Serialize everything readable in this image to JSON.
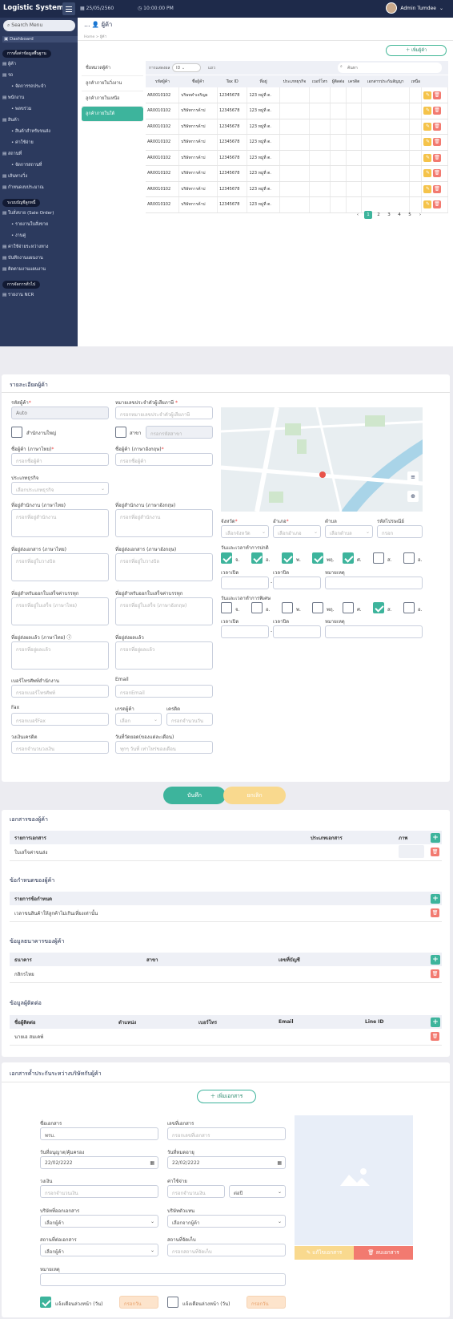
{
  "app_title": "Logistic System",
  "topbar": {
    "date": "25/05/2560",
    "time": "10:00:00 PM",
    "user": "Admin Tumdee"
  },
  "sidebar": {
    "search_placeholder": "Search Menu",
    "dashboard": "Dashboard",
    "sec1": "การตั้งค่าข้อมูลพื้นฐาน",
    "items1": [
      "ผู้ค้า",
      "รถ",
      "จัดการรถประจำ",
      "พนักงาน",
      "พลขร่วม",
      "สินค้า",
      "สินค้าสำหรับขนส่ง",
      "ค่าใช้จ่าย",
      "สถานที่",
      "จัดการสถานที่",
      "เส้นทางวิ่ง",
      "กำหนดงบประมาณ"
    ],
    "sec2": "ระบบบัญชีลูกหนี้",
    "items2": [
      "ใบสั่งขาย (Sale Order)",
      "รายงานใบสั่งขาย",
      "งานคู่",
      "ค่าใช้จ่ายระหว่างทาง",
      "บันทึกงานแผนงาน",
      "ติดตามงานแผนงาน"
    ],
    "sec3": "การจัดการทั่วไป",
    "items3": [
      "รายงาน NCR"
    ]
  },
  "page": {
    "title": "ผู้ค้า",
    "breadcrumb": "Home > ผู้ค้า",
    "add_label": "เพิ่มผู้ค้า",
    "tabs": [
      "ชื่อหมวดผู้ค้า",
      "ลูกค้าภายในวิ่งงาน",
      "ลูกค้าภายในเหนือ",
      "ลูกค้าภายในใต้"
    ],
    "filter": {
      "label": "การแสดงผล",
      "select": "ID",
      "extra": "แถว",
      "search": "ค้นหา"
    },
    "columns": [
      "รหัสผู้ค้า",
      "ชื่อผู้ค้า",
      "Tax ID",
      "ที่อยู่",
      "ประเภทธุรกิจ",
      "เบอร์โทร",
      "ผู้ติดต่อ",
      "เครดิต",
      "เอกสารประกันสัญญา",
      "เหนือ"
    ],
    "rows": [
      [
        "AR0010102",
        "บริษทคำเจริญผ",
        "12345678",
        "123 หมู่ที่ ต."
      ],
      [
        "AR0010102",
        "บริษัทการค้าบ่",
        "12345678",
        "123 หมู่ที่ ต."
      ],
      [
        "AR0010102",
        "บริษัทการค้าบ่",
        "12345678",
        "123 หมู่ที่ ต."
      ],
      [
        "AR0010102",
        "บริษัทการค้าบ่",
        "12345678",
        "123 หมู่ที่ ต."
      ],
      [
        "AR0010102",
        "บริษัทการค้าบ่",
        "12345678",
        "123 หมู่ที่ ต."
      ],
      [
        "AR0010102",
        "บริษัทการค้าบ่",
        "12345678",
        "123 หมู่ที่ ต."
      ],
      [
        "AR0010102",
        "บริษัทการค้าบ่",
        "12345678",
        "123 หมู่ที่ ต."
      ],
      [
        "AR0010102",
        "บริษัทการค้าบ่",
        "12345678",
        "123 หมู่ที่ ต."
      ]
    ],
    "pages": [
      "1",
      "2",
      "3",
      "4",
      "5"
    ]
  },
  "detail": {
    "title": "รายละเอียดผู้ค้า",
    "code_label": "รหัสผู้ค้า",
    "code_value": "Auto",
    "tax_label": "หมายเลขประจำตัวผู้เสียภาษี",
    "tax_ph": "กรอกหมายเลขประจำตัวผู้เสียภาษี",
    "hq": "สำนักงานใหญ่",
    "branch": "สาขา",
    "branch_ph": "กรอกรหัสสาขา",
    "name_th": "ชื่อผู้ค้า (ภาษาไทย)",
    "name_th_ph": "กรอกชื่อผู้ค้า",
    "name_en": "ชื่อผู้ค้า (ภาษาอังกฤษ)",
    "name_en_ph": "กรอกชื่อผู้ค้า",
    "biz": "ประเภทธุรกิจ",
    "biz_ph": "เลือกประเภทธุรกิจ",
    "addr_office_th": "ที่อยู่สำนักงาน (ภาษาไทย)",
    "addr_office_ph": "กรอกที่อยู่สำนักงาน",
    "addr_office_en": "ที่อยู่สำนักงาน (ภาษาอังกฤษ)",
    "addr_office_en_ph": "กรอกที่อยู่สำนักงาน",
    "addr_doc_th": "ที่อยู่ส่งเอกสาร (ภาษาไทย)",
    "addr_doc_ph": "กรอกที่อยู่ใบวางบิล",
    "addr_doc_en": "ที่อยู่ส่งเอกสาร (ภาษาอังกฤษ)",
    "addr_doc_en_ph": "กรอกที่อยู่ใบวางบิล",
    "addr_inv_th": "ที่อยู่สำหรับออกใบเสร็จค่าบรรทุก",
    "addr_inv_ph": "กรอกที่อยู่ใบเสร็จ (ภาษาไทย)",
    "addr_inv_en": "ที่อยู่สำหรับออกใบเสร็จค่าบรรทุก",
    "addr_inv_en_ph": "กรอกที่อยู่ใบเสร็จ (ภาษาอังกฤษ)",
    "addr_ship_th": "ที่อยู่ส่งผลแล้ว (ภาษาไทย)",
    "addr_ship_ph": "กรอกที่อยู่ผลแล้ว",
    "addr_ship_en": "ที่อยู่ส่งผลแล้ว",
    "addr_ship_en_ph": "กรอกที่อยู่ผลแล้ว",
    "phone": "เบอร์โทรศัพท์สำนักงาน",
    "phone_ph": "กรอกเบอร์โทรศัพท์",
    "email": "Email",
    "email_ph": "กรอกEmail",
    "fax": "Fax",
    "fax_ph": "กรอกเบอร์Fax",
    "grade": "เกรดผู้ค้า",
    "grade_ph": "เลือก",
    "credit": "เครดิต",
    "credit_ph": "กรอกจำนวนวัน",
    "limit": "วงเงินเครดิต",
    "limit_ph": "กรอกจำนวนวงเงิน",
    "bill": "วันที่วัดยอด(ของแต่ละเดือน)",
    "bill_ph": "ทุกๆ วันที่ เท่าไหร่ของเดือน",
    "province": "จังหวัด",
    "province_ph": "เลือกจังหวัด",
    "district": "อำเภอ",
    "district_ph": "เลือกอำเภอ",
    "subdistrict": "ตำบล",
    "subdistrict_ph": "เลือกตำบล",
    "zip": "รหัสไปรษณีย์",
    "zip_ph": "กรอก",
    "normal": "วันและเวลาทำการปกติ",
    "special": "วันและเวลาทำการพิเศษ",
    "days": [
      "จ.",
      "อ.",
      "พ.",
      "พฤ.",
      "ศ.",
      "ส.",
      "อ."
    ],
    "open": "เวลาเปิด",
    "close": "เวลาปิด",
    "note": "หมายเหตุ",
    "save": "บันทึก",
    "cancel": "ยกเลิก"
  },
  "docs": {
    "title": "เอกสารของผู้ค้า",
    "col1": "รายการเอกสาร",
    "col2": "ประเภทเอกสาร",
    "col3": "ภาพ",
    "row": "ใบเสร็จค่าขนส่ง"
  },
  "rules": {
    "title": "ข้อกำหนดของผู้ค้า",
    "col1": "รายการข้อกำหนด",
    "row": "เวลาขนสินค้าให้ลูกค้าไม่เกินเที่ยงเท่านั้น"
  },
  "bank": {
    "title": "ข้อมูลธนาคารของผู้ค้า",
    "col1": "ธนาคาร",
    "col2": "สาขา",
    "col3": "เลขที่บัญชี",
    "row": "กสิกรไทย"
  },
  "contacts": {
    "title": "ข้อมูลผู้ติดต่อ",
    "col1": "ชื่อผู้ติดต่อ",
    "col2": "ตำแหน่ง",
    "col3": "เบอร์โทร",
    "col4": "Email",
    "col5": "Line ID",
    "row": "นายเอ สมเคพ์"
  },
  "contract": {
    "title": "เอกสารค้ำประกันระหว่างบริษัทกับผู้ค้า",
    "add": "เพิ่มเอกสาร",
    "docname": "ชื่อเอกสาร",
    "docname_val": "พรบ.",
    "docno": "เลขที่เอกสาร",
    "docno_ph": "กรอกเลขที่เอกสาร",
    "issue": "วันที่อนุญาต/คุ้มครอง",
    "issue_val": "22/02/2222",
    "expire": "วันที่หมดอายุ",
    "expire_val": "22/02/2222",
    "amount": "วงเงิน",
    "amount_ph": "กรอกจำนวนเงิน",
    "cost": "ค่าใช้จ่าย",
    "cost_ph": "กรอกจำนวนเงิน",
    "per": "ต่อปี",
    "issuer": "บริษัทที่ออกเอกสาร",
    "issuer_ph": "เลือกผู้ค้า",
    "agent": "บริษัทตัวแทน",
    "agent_ph": "เลือกจากผู้ค้า",
    "place": "สถานที่ต่อเอกสาร",
    "place_ph": "เลือกผู้ค้า",
    "store": "สถานที่จัดเก็บ",
    "store_ph": "กรอกสถานที่จัดเก็บ",
    "remark": "หมายเหตุ",
    "notify1": "แจ้งเตือนล่วงหน้า (วัน)",
    "notify_ph": "กรอกวัน",
    "notify2": "แจ้งเตือนล่วงหน้า (วัน)",
    "edit": "แก้ไขเอกสาร",
    "delete": "ลบเอกสาร"
  }
}
